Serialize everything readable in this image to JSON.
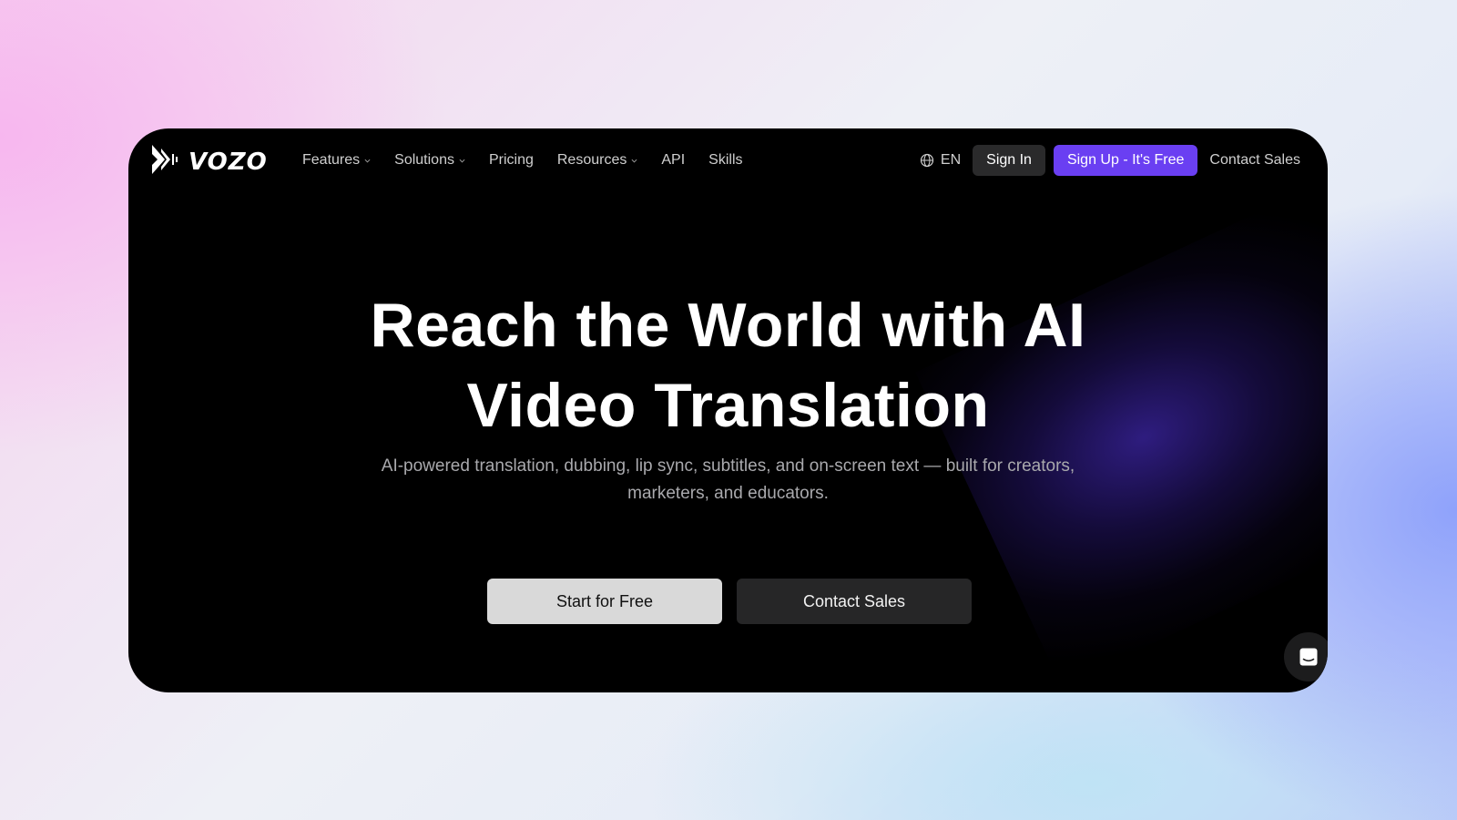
{
  "brand": {
    "name": "VOZO"
  },
  "nav": {
    "items": [
      {
        "label": "Features",
        "dropdown": true
      },
      {
        "label": "Solutions",
        "dropdown": true
      },
      {
        "label": "Pricing",
        "dropdown": false
      },
      {
        "label": "Resources",
        "dropdown": true
      },
      {
        "label": "API",
        "dropdown": false
      },
      {
        "label": "Skills",
        "dropdown": false
      }
    ],
    "language": "EN",
    "sign_in": "Sign In",
    "sign_up": "Sign Up - It's Free",
    "contact_sales": "Contact Sales"
  },
  "hero": {
    "title_line1": "Reach the World with AI",
    "title_line2": "Video Translation",
    "subtitle_line1": "AI-powered translation, dubbing, lip sync, subtitles, and on-screen text — built for creators,",
    "subtitle_line2": "marketers, and educators.",
    "cta_primary": "Start for Free",
    "cta_secondary": "Contact Sales"
  },
  "icons": [
    "vozo-logo-icon",
    "chevron-down-icon",
    "globe-icon",
    "chat-icon"
  ],
  "colors": {
    "accent": "#6a3ff2",
    "background": "#000000",
    "primary_cta": "#d9d9d9",
    "secondary_cta": "#262627"
  }
}
